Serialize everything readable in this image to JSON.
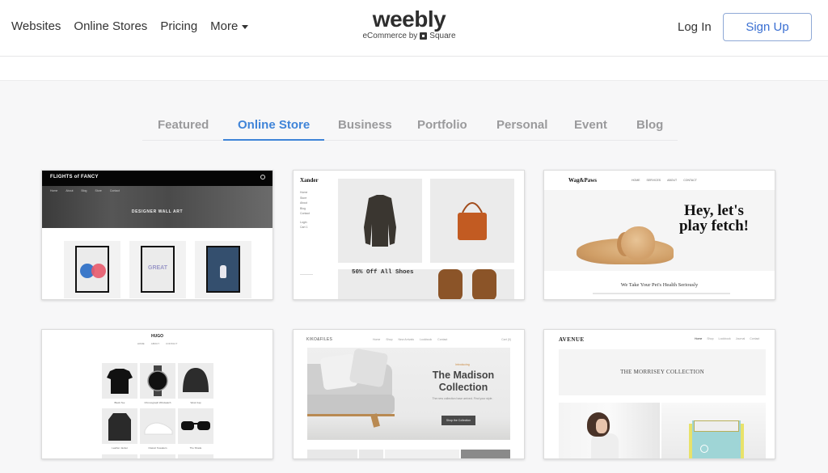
{
  "header": {
    "nav": [
      {
        "label": "Websites"
      },
      {
        "label": "Online Stores"
      },
      {
        "label": "Pricing"
      },
      {
        "label": "More"
      }
    ],
    "logo": {
      "wordmark": "weebly",
      "tagline_prefix": "eCommerce by",
      "tagline_brand": "Square"
    },
    "login_label": "Log In",
    "signup_label": "Sign Up"
  },
  "tabs": {
    "items": [
      {
        "label": "Featured"
      },
      {
        "label": "Online Store"
      },
      {
        "label": "Business"
      },
      {
        "label": "Portfolio"
      },
      {
        "label": "Personal"
      },
      {
        "label": "Event"
      },
      {
        "label": "Blog"
      }
    ],
    "active": "Online Store"
  },
  "colors": {
    "accent": "#3f84d8",
    "signup_border": "#8fa9d6",
    "tab_inactive": "#9a9a9c"
  },
  "templates": [
    {
      "brand": "FLIGHTS of FANCY",
      "menu": [
        "Home",
        "About",
        "Blog",
        "Store",
        "Contact"
      ],
      "hero_text": "DESIGNER WALL ART",
      "product_text": "GREAT"
    },
    {
      "brand": "Xander",
      "menu": [
        "Home",
        "Store",
        "About",
        "Blog",
        "Contact"
      ],
      "account": [
        "Login",
        "Cart  1"
      ],
      "promo": "50% Off All Shoes"
    },
    {
      "brand": "Wag&Paws",
      "menu": [
        "HOME",
        "SERVICES",
        "ABOUT",
        "CONTACT"
      ],
      "headline": "Hey, let's play fetch!",
      "subheading": "We Take Your Pet's Health Seriously"
    },
    {
      "brand": "HUGO",
      "menu": [
        "HOME",
        "ABOUT",
        "CONTACT"
      ],
      "products": [
        "Black Tee",
        "Chronograph Wristwatch",
        "Wool Cap",
        "Leather Jacket",
        "Classic Sneakers",
        "The Shade"
      ]
    },
    {
      "brand": "KIKO&FILES",
      "menu": [
        "Home",
        "Shop",
        "New Arrivals",
        "Lookbook",
        "Contact"
      ],
      "cart": "Cart (0)",
      "intro": "Introducing",
      "title": "The Madison Collection",
      "description": "The new collection have arrived. Find your style.",
      "button": "Shop the Collection"
    },
    {
      "brand": "AVENUE",
      "menu": [
        "Home",
        "Shop",
        "Lookbook",
        "Journal",
        "Contact"
      ],
      "title": "THE MORRISEY COLLECTION"
    }
  ]
}
